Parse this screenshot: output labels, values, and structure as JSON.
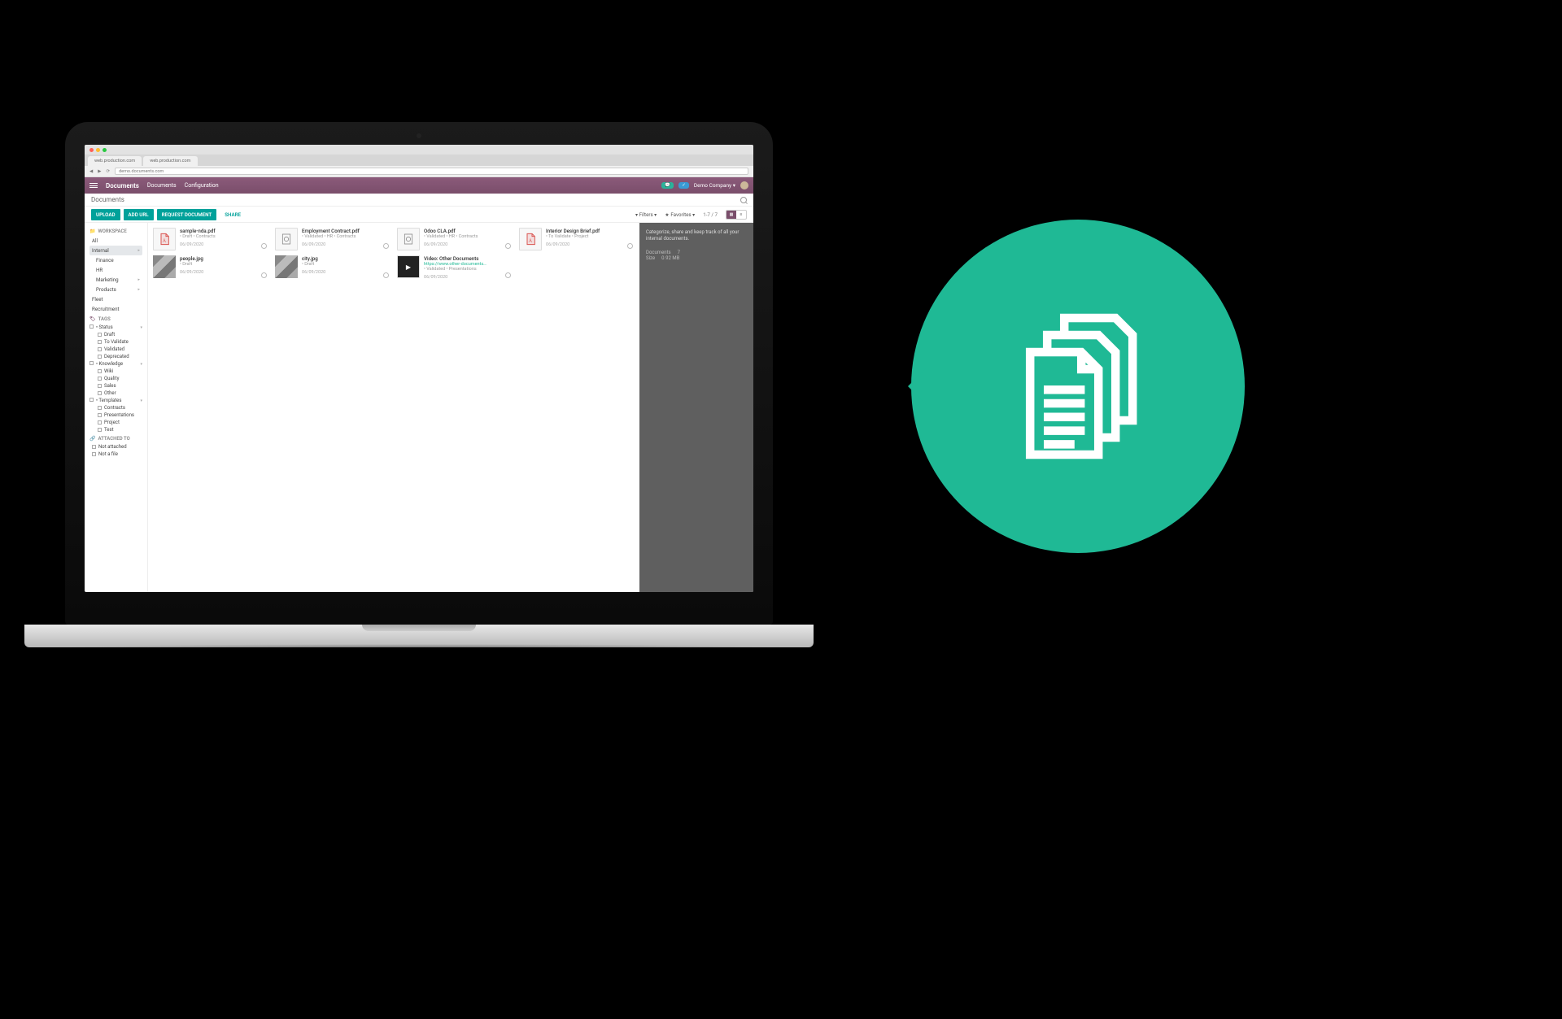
{
  "browser": {
    "tab1": "web.production.com",
    "tab2": "web.production.com",
    "url": "demo.documents.com"
  },
  "app": {
    "title": "Documents",
    "nav": {
      "documents": "Documents",
      "configuration": "Configuration"
    },
    "company": "Demo Company ▾"
  },
  "crumb": "Documents",
  "actions": {
    "upload": "UPLOAD",
    "add_url": "ADD URL",
    "request": "REQUEST DOCUMENT",
    "share": "SHARE",
    "filters": "▾ Filters ▾",
    "favorites": "★ Favorites ▾",
    "count": "1-7 / 7"
  },
  "sidebar": {
    "workspace_header": "WORKSPACE",
    "workspaces": [
      {
        "label": "All",
        "sel": false,
        "sub": false
      },
      {
        "label": "Internal",
        "sel": true,
        "sub": false,
        "exp": true
      },
      {
        "label": "Finance",
        "sel": false,
        "sub": true
      },
      {
        "label": "HR",
        "sel": false,
        "sub": true
      },
      {
        "label": "Marketing",
        "sel": false,
        "sub": true,
        "exp": true
      },
      {
        "label": "Products",
        "sel": false,
        "sub": true,
        "exp": true
      },
      {
        "label": "Fleet",
        "sel": false,
        "sub": false
      },
      {
        "label": "Recruitment",
        "sel": false,
        "sub": false
      }
    ],
    "tags_header": "TAGS",
    "tag_groups": [
      {
        "label": "Status",
        "tags": [
          "Draft",
          "To Validate",
          "Validated",
          "Deprecated"
        ]
      },
      {
        "label": "Knowledge",
        "tags": [
          "Wiki",
          "Quality",
          "Sales",
          "Other"
        ]
      },
      {
        "label": "Templates",
        "tags": [
          "Contracts",
          "Presentations",
          "Project",
          "Test"
        ]
      }
    ],
    "attached_header": "ATTACHED TO",
    "attached": [
      "Not attached",
      "Not a file"
    ]
  },
  "docs": [
    {
      "name": "sample-nda.pdf",
      "path": "• Draft • Contracts",
      "date": "06/09/2020",
      "type": "pdf"
    },
    {
      "name": "Employment Contract.pdf",
      "path": "• Validated • HR • Contracts",
      "date": "06/09/2020",
      "type": "doc"
    },
    {
      "name": "Odoo CLA.pdf",
      "path": "• Validated • HR • Contracts",
      "date": "06/09/2020",
      "type": "doc"
    },
    {
      "name": "Interior Design Brief.pdf",
      "path": "• To Validate • Project",
      "date": "06/09/2020",
      "type": "pdf"
    },
    {
      "name": "people.jpg",
      "path": "• Draft",
      "date": "06/09/2020",
      "type": "img"
    },
    {
      "name": "city.jpg",
      "path": "• Draft",
      "date": "06/09/2020",
      "type": "img"
    },
    {
      "name": "Video: Other Documents",
      "path": "https://www.other-documents…",
      "date": "06/09/2020",
      "type": "vid",
      "path2": "• Validated • Presentations"
    }
  ],
  "info": {
    "tagline": "Categorize, share and keep track of all your internal documents.",
    "doc_label": "Documents",
    "doc_count": "7",
    "size_label": "Size",
    "size_value": "0.92 MB"
  }
}
